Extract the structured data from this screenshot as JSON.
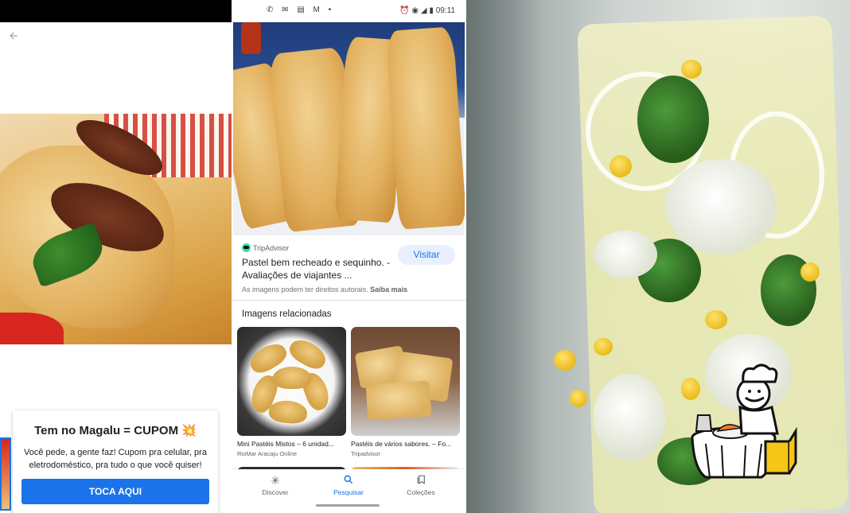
{
  "left_panel": {
    "back_icon": "arrow-back-icon",
    "ad": {
      "title": "Tem no Magalu = CUPOM 💥",
      "body": "Você pede, a gente faz! Cupom pra celular, pra eletrodoméstico, pra tudo o que você quiser!",
      "button_label": "TOCA AQUI"
    }
  },
  "middle_panel": {
    "status_bar": {
      "left_icons": [
        "whatsapp-icon",
        "notification-icon",
        "document-icon",
        "gmail-icon",
        "dot-icon"
      ],
      "left_glyphs": "✆ ✉ ▤ M •",
      "right_icons": [
        "alarm-icon",
        "eye-icon",
        "wifi-icon",
        "battery-icon"
      ],
      "right_glyphs": "⏰ ◉ ◢ ▮",
      "time": "09:11"
    },
    "result": {
      "source": "TripAdvisor",
      "title": "Pastel bem recheado e sequinho. - Avaliações de viajantes ...",
      "visit_label": "Visitar",
      "copyright": "As imagens podem ter direitos autorais.",
      "learn_more": "Saiba mais"
    },
    "related": {
      "heading": "Imagens relacionadas",
      "items": [
        {
          "caption": "Mini Pastéis Mistos – 6 unidad...",
          "source": "RioMar Aracaju Online"
        },
        {
          "caption": "Pastéis de vários sabores. – Fo...",
          "source": "Tripadvisor"
        }
      ]
    },
    "bottom_nav": [
      {
        "label": "Discover",
        "icon": "asterisk-icon",
        "glyph": "✳",
        "active": false
      },
      {
        "label": "Pesquisar",
        "icon": "search-icon",
        "glyph": "⌕",
        "active": true
      },
      {
        "label": "Coleções",
        "icon": "bookmarks-icon",
        "glyph": "❐",
        "active": false
      }
    ]
  },
  "colors": {
    "accent_blue": "#1a73e8",
    "visit_button_bg": "#e8f0fe",
    "status_bar_black": "#000000"
  }
}
